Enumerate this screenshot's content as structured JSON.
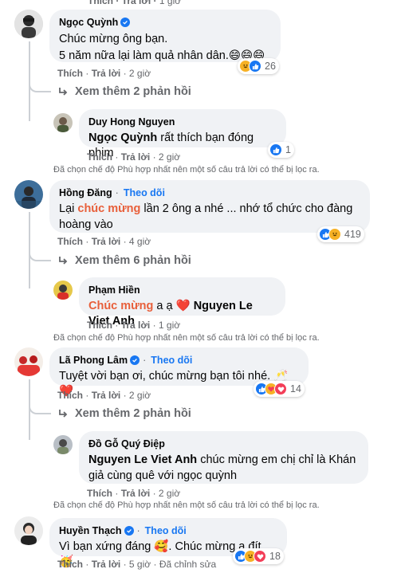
{
  "top_cut": {
    "like": "Thích",
    "reply": "Trả lời",
    "time": "1 giờ"
  },
  "comments": [
    {
      "name": "Ngọc Quỳnh",
      "line1": "Chúc mừng ông bạn.",
      "line2": "5 năm nữa lại làm quả nhân dân.",
      "emoji": "😄😄😄",
      "like": "Thích",
      "reply": "Trả lời",
      "time": "2 giờ",
      "reaction_count": "26"
    },
    {
      "name": "Duy Hong Nguyen",
      "mention": "Ngọc Quỳnh",
      "text": "rất thích bạn đóng phim",
      "like": "Thích",
      "reply": "Trả lời",
      "time": "2 giờ",
      "reaction_count": "1"
    },
    {
      "name": "Hồng Đăng",
      "follow": "Theo dõi",
      "text_a": "Lại ",
      "highlight": "chúc mừng",
      "text_b": " lần 2 ông a nhé ... nhớ tổ chức cho đàng",
      "line2": "hoàng vào",
      "like": "Thích",
      "reply": "Trả lời",
      "time": "4 giờ",
      "reaction_count": "419"
    },
    {
      "name": "Phạm Hiền",
      "highlight": "Chúc mừng",
      "text": " a ạ ",
      "heart": "❤️",
      "mention": "Nguyen Le Viet Anh",
      "like": "Thích",
      "reply": "Trả lời",
      "time": "1 giờ"
    },
    {
      "name": "Lã Phong Lâm",
      "follow": "Theo dõi",
      "text": "Tuyệt vời bạn ơi, chúc mừng bạn tôi nhé.",
      "emoji": "🥂❤️",
      "like": "Thích",
      "reply": "Trả lời",
      "time": "2 giờ",
      "reaction_count": "14"
    },
    {
      "name": "Đồ Gỗ Quý Điệp",
      "mention": "Nguyen Le Viet Anh",
      "text": " chúc mừng em chị chỉ là Khán",
      "line2": "giả cùng quê với ngọc quỳnh",
      "like": "Thích",
      "reply": "Trả lời",
      "time": "2 giờ"
    },
    {
      "name": "Huyền Thạch",
      "follow": "Theo dõi",
      "text": "Vì bạn xứng đáng ",
      "emoji1": "🥰",
      "text2": ". Chúc mừng a đít ",
      "emoji2": "🥳",
      "like": "Thích",
      "reply": "Trả lời",
      "time": "5 giờ",
      "edited": "Đã chỉnh sửa",
      "reaction_count": "18"
    }
  ],
  "more_replies": [
    {
      "label": "Xem thêm 2 phản hồi"
    },
    {
      "label": "Xem thêm 6 phản hồi"
    },
    {
      "label": "Xem thêm 2 phản hồi"
    }
  ],
  "filter_note": "Đã chọn chế độ Phù hợp nhất nên một số câu trả lời có thể bị lọc ra.",
  "dot": "·",
  "colors": {
    "accent": "#1877f2",
    "highlight": "#e85f3a",
    "bubble": "#f0f2f5",
    "muted": "#65676b"
  }
}
